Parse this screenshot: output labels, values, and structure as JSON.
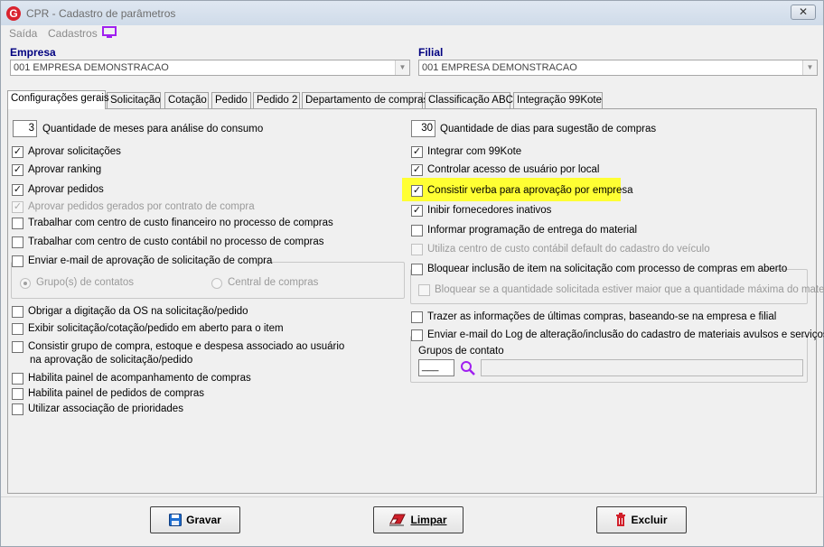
{
  "window": {
    "title": "CPR - Cadastro de parâmetros",
    "close_symbol": "✕",
    "logo_letter": "G"
  },
  "menu": {
    "items": [
      "Saída",
      "Cadastros"
    ],
    "icon": "monitor-icon"
  },
  "empresa": {
    "label": "Empresa",
    "value": "001 EMPRESA DEMONSTRACAO"
  },
  "filial": {
    "label": "Filial",
    "value": "001 EMPRESA DEMONSTRACAO"
  },
  "tabs": [
    {
      "label": "Configurações gerais",
      "active": true
    },
    {
      "label": "Solicitação"
    },
    {
      "label": "Cotação"
    },
    {
      "label": "Pedido"
    },
    {
      "label": "Pedido 2"
    },
    {
      "label": "Departamento de compras"
    },
    {
      "label": "Classificação ABC"
    },
    {
      "label": "Integração 99Kote"
    }
  ],
  "left": {
    "meses_value": "3",
    "meses_label": "Quantidade de meses para análise do consumo",
    "checks": [
      {
        "label": "Aprovar solicitações",
        "checked": true
      },
      {
        "label": "Aprovar ranking",
        "checked": true
      },
      {
        "label": "Aprovar pedidos",
        "checked": true
      },
      {
        "label": "Aprovar pedidos gerados por contrato de compra",
        "checked": true,
        "disabled": true
      },
      {
        "label": "Trabalhar com centro de custo financeiro no processo de compras",
        "checked": false
      },
      {
        "label": "Trabalhar com centro de custo contábil no processo de compras",
        "checked": false
      }
    ],
    "email_frame_label": "Enviar e-mail de aprovação de solicitação de compra",
    "radio_grupos": "Grupo(s) de contatos",
    "radio_central": "Central de compras",
    "checks2": [
      {
        "label": "Obrigar a digitação da OS na solicitação/pedido",
        "checked": false
      },
      {
        "label": "Exibir solicitação/cotação/pedido em aberto para o item",
        "checked": false
      },
      {
        "label": "Consistir grupo de compra, estoque e despesa associado ao usuário",
        "checked": false
      },
      {
        "label": "Habilita painel de acompanhamento de compras",
        "checked": false
      },
      {
        "label": "Habilita painel de pedidos de compras",
        "checked": false
      },
      {
        "label": "Utilizar associação de prioridades",
        "checked": false
      }
    ],
    "consistir_line2": "na aprovação de solicitação/pedido"
  },
  "right": {
    "dias_value": "30",
    "dias_label": "Quantidade de dias para sugestão de compras",
    "checks": [
      {
        "label": "Integrar com 99Kote",
        "checked": true
      },
      {
        "label": "Controlar acesso de usuário por local",
        "checked": true
      },
      {
        "label": "Consistir verba para aprovação por empresa",
        "checked": true
      },
      {
        "label": "Inibir fornecedores inativos",
        "checked": true
      },
      {
        "label": "Informar programação de entrega do material",
        "checked": false
      },
      {
        "label": "Utiliza centro de custo contábil default do cadastro do veículo",
        "checked": false,
        "disabled": true
      }
    ],
    "bloquear_label": "Bloquear inclusão de item na solicitação com processo de compras em aberto",
    "bloquear_sub": "Bloquear se a quantidade solicitada estiver maior que a quantidade máxima do material",
    "trazer_label": "Trazer as informações de últimas compras, baseando-se na empresa e filial",
    "enviar_log_label": "Enviar e-mail do Log de alteração/inclusão do cadastro de materiais avulsos e serviços",
    "grupos_label": "Grupos de contato",
    "grupos_code": "___"
  },
  "buttons": {
    "gravar": "Gravar",
    "limpar": "Limpar",
    "excluir": "Excluir"
  },
  "colors": {
    "highlight": "#ffff33",
    "label_blue": "#000080",
    "logo_red": "#d9232e",
    "monitor_purple": "#a020f0"
  }
}
